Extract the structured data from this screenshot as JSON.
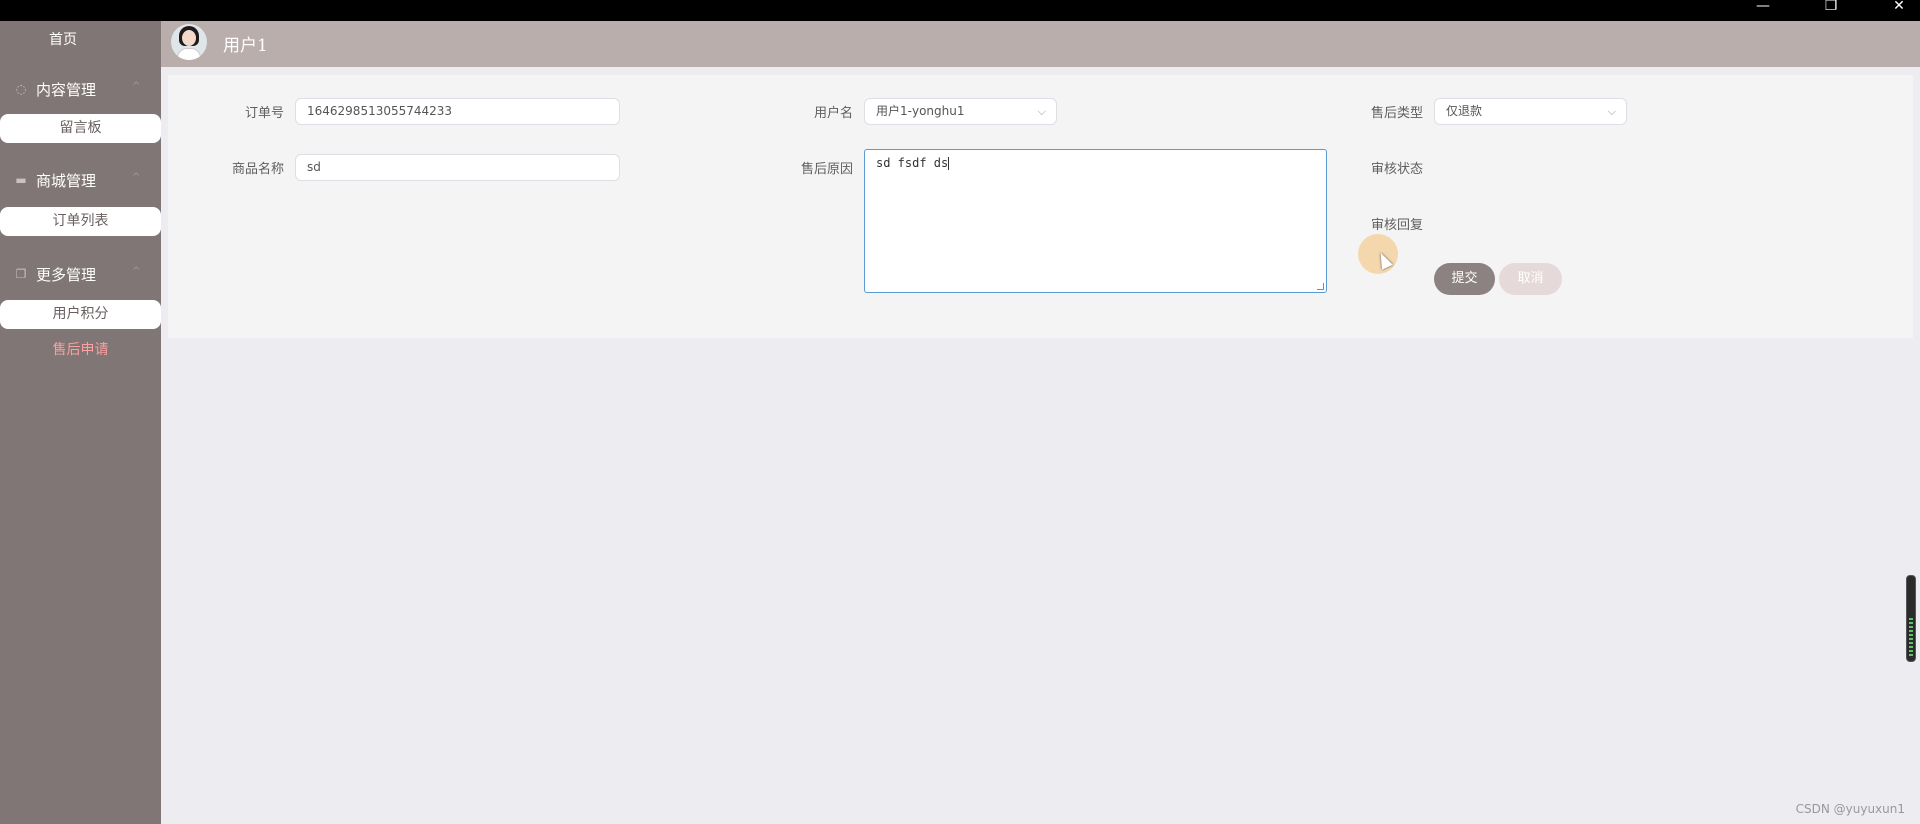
{
  "window": {
    "minimize": "—",
    "restore": "❐",
    "close": "✕"
  },
  "sidebar": {
    "home": "首页",
    "groups": [
      {
        "title": "内容管理",
        "icon": "comment-icon",
        "items": [
          "留言板"
        ]
      },
      {
        "title": "商城管理",
        "icon": "bag-icon",
        "items": [
          "订单列表"
        ]
      },
      {
        "title": "更多管理",
        "icon": "copy-icon",
        "items": [
          "用户积分",
          "售后申请"
        ]
      }
    ],
    "chevron": "^"
  },
  "header": {
    "username": "用户1"
  },
  "form": {
    "order_no_label": "订单号",
    "order_no": "1646298513055744233",
    "username_label": "用户名",
    "username_value": "用户1-yonghu1",
    "aftersale_type_label": "售后类型",
    "aftersale_type_value": "仅退款",
    "product_name_label": "商品名称",
    "product_name": "sd",
    "reason_label": "售后原因",
    "reason_text": "sd fsdf ds",
    "review_status_label": "审核状态",
    "review_reply_label": "审核回复",
    "submit_label": "提交",
    "cancel_label": "取消"
  },
  "watermark": "CSDN @yuyuxun1"
}
